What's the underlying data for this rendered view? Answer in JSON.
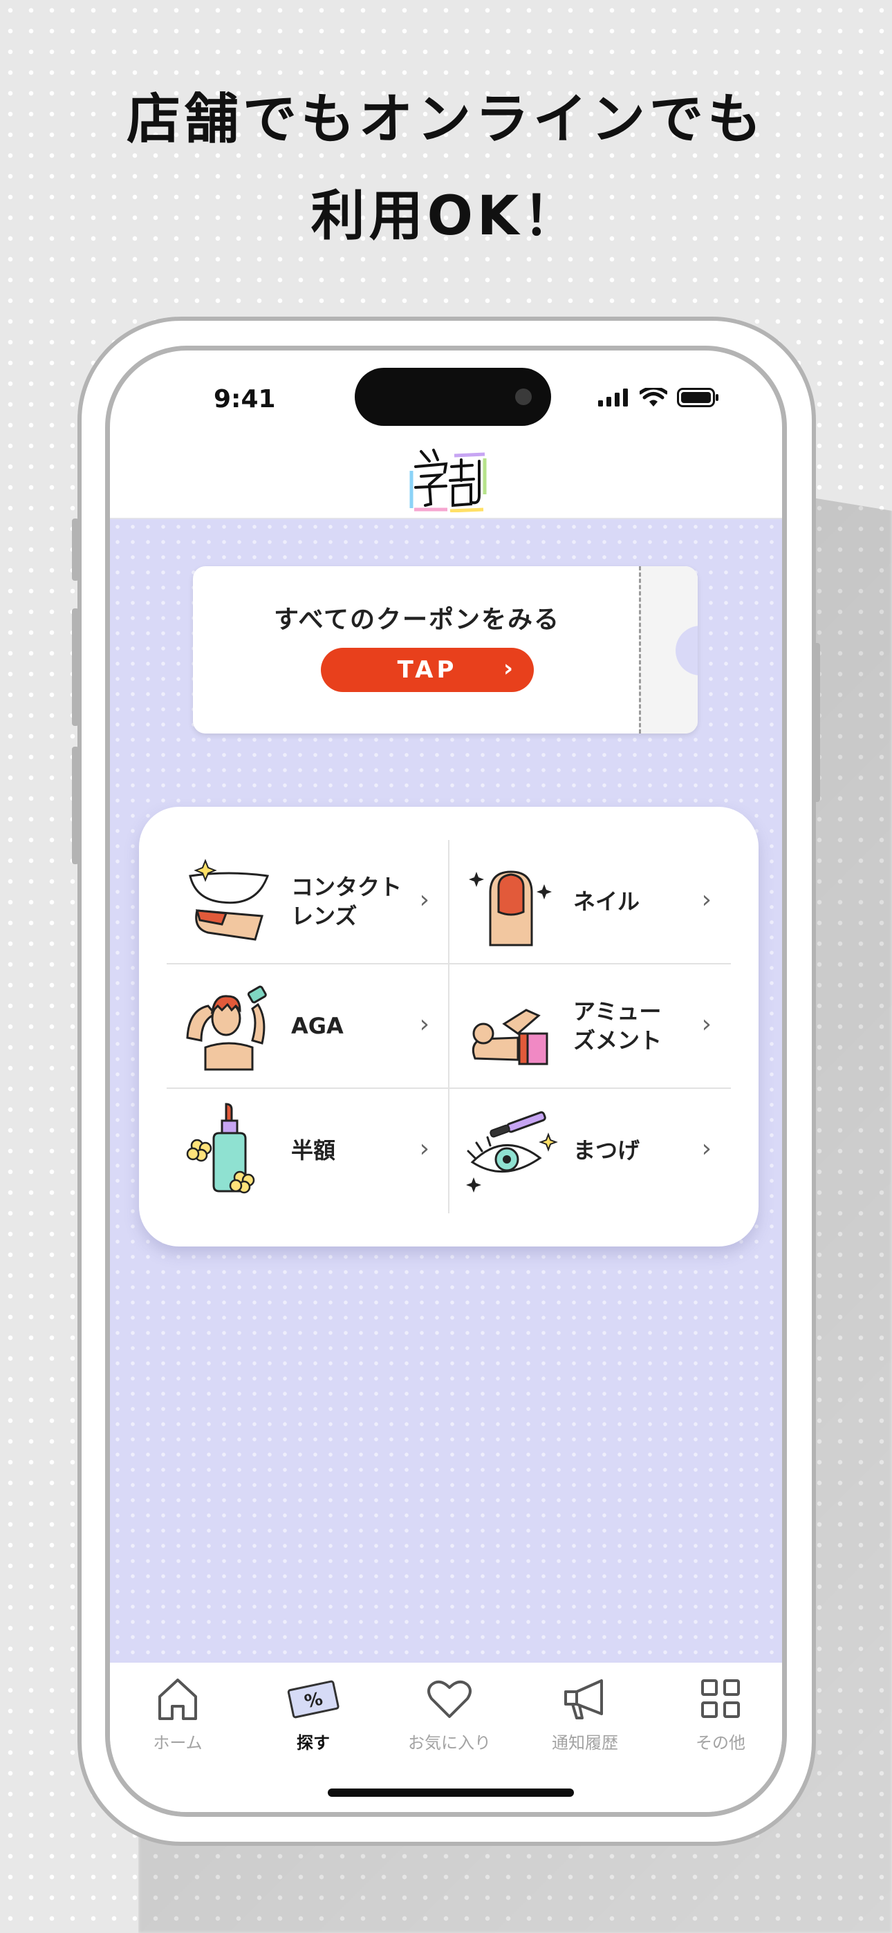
{
  "headline": {
    "line1": "店舗でもオンラインでも",
    "line2": "利用OK！"
  },
  "status_bar": {
    "time": "9:41"
  },
  "coupon": {
    "title": "すべてのクーポンをみる",
    "button_label": "TAP",
    "chevron": "›"
  },
  "categories": [
    {
      "label": "コンタクト\nレンズ",
      "icon": "contact-lens-icon"
    },
    {
      "label": "ネイル",
      "icon": "nail-icon"
    },
    {
      "label": "AGA",
      "icon": "hair-growth-icon"
    },
    {
      "label": "アミュー\nズメント",
      "icon": "amusement-icon"
    },
    {
      "label": "半額",
      "icon": "half-price-bottle-icon"
    },
    {
      "label": "まつげ",
      "icon": "eyelash-icon"
    }
  ],
  "tabbar": {
    "items": [
      {
        "label": "ホーム",
        "icon": "home-icon",
        "active": false
      },
      {
        "label": "探す",
        "icon": "coupon-search-icon",
        "active": true
      },
      {
        "label": "お気に入り",
        "icon": "heart-icon",
        "active": false
      },
      {
        "label": "通知履歴",
        "icon": "megaphone-icon",
        "active": false
      },
      {
        "label": "その他",
        "icon": "grid-icon",
        "active": false
      }
    ]
  },
  "colors": {
    "accent": "#e8401c",
    "content_bg": "#d9d9f7"
  }
}
